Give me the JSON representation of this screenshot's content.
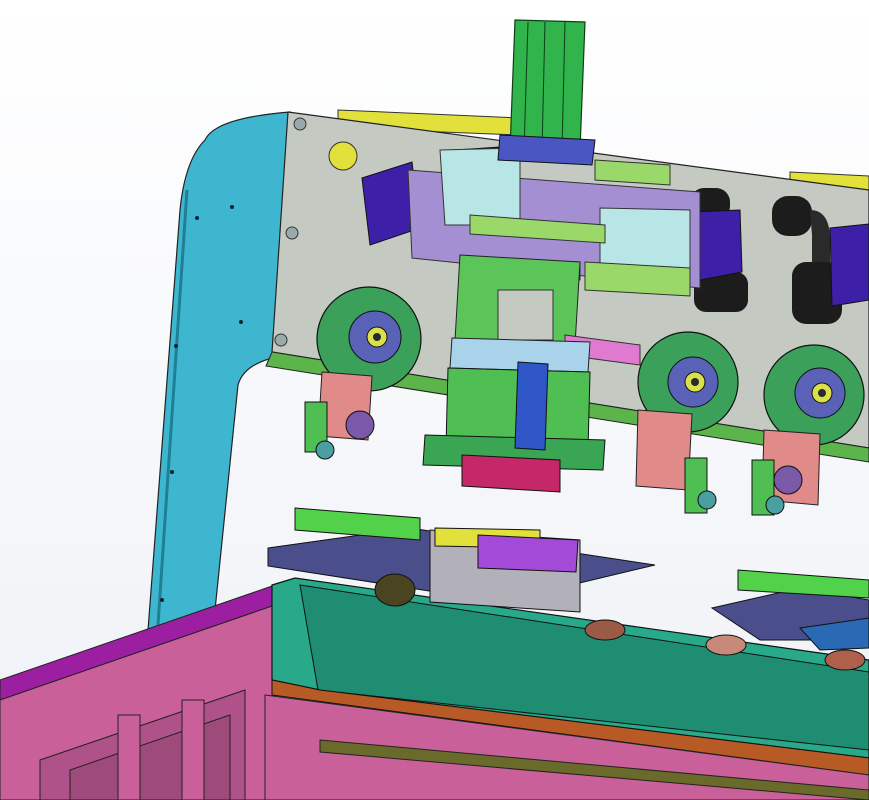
{
  "scene": {
    "colors": {
      "background_top": "#ffffff",
      "background_bottom": "#eef1f6",
      "pillar": "#3fb6cf",
      "back_plate": "#c4cac1",
      "base_frame": "#c9609a",
      "base_frame_dark": "#9e4a7a",
      "base_top": "#27a98a",
      "base_top_dark": "#1f8d72",
      "copper_strip": "#b85a25",
      "cylinder_green": "#31b44b",
      "bracket_purple": "#3d1fa8",
      "wheel_green": "#3aa05a",
      "wheel_hub": "#5a62b8",
      "lilac_block": "#a58fd3",
      "light_green": "#9bd86a",
      "yellow_part": "#e2e03a",
      "salmon_plate": "#e08a8a",
      "crimson_block": "#c42868",
      "navy_plate": "#4a4f8c",
      "black_gripper": "#1c1c1c"
    }
  }
}
